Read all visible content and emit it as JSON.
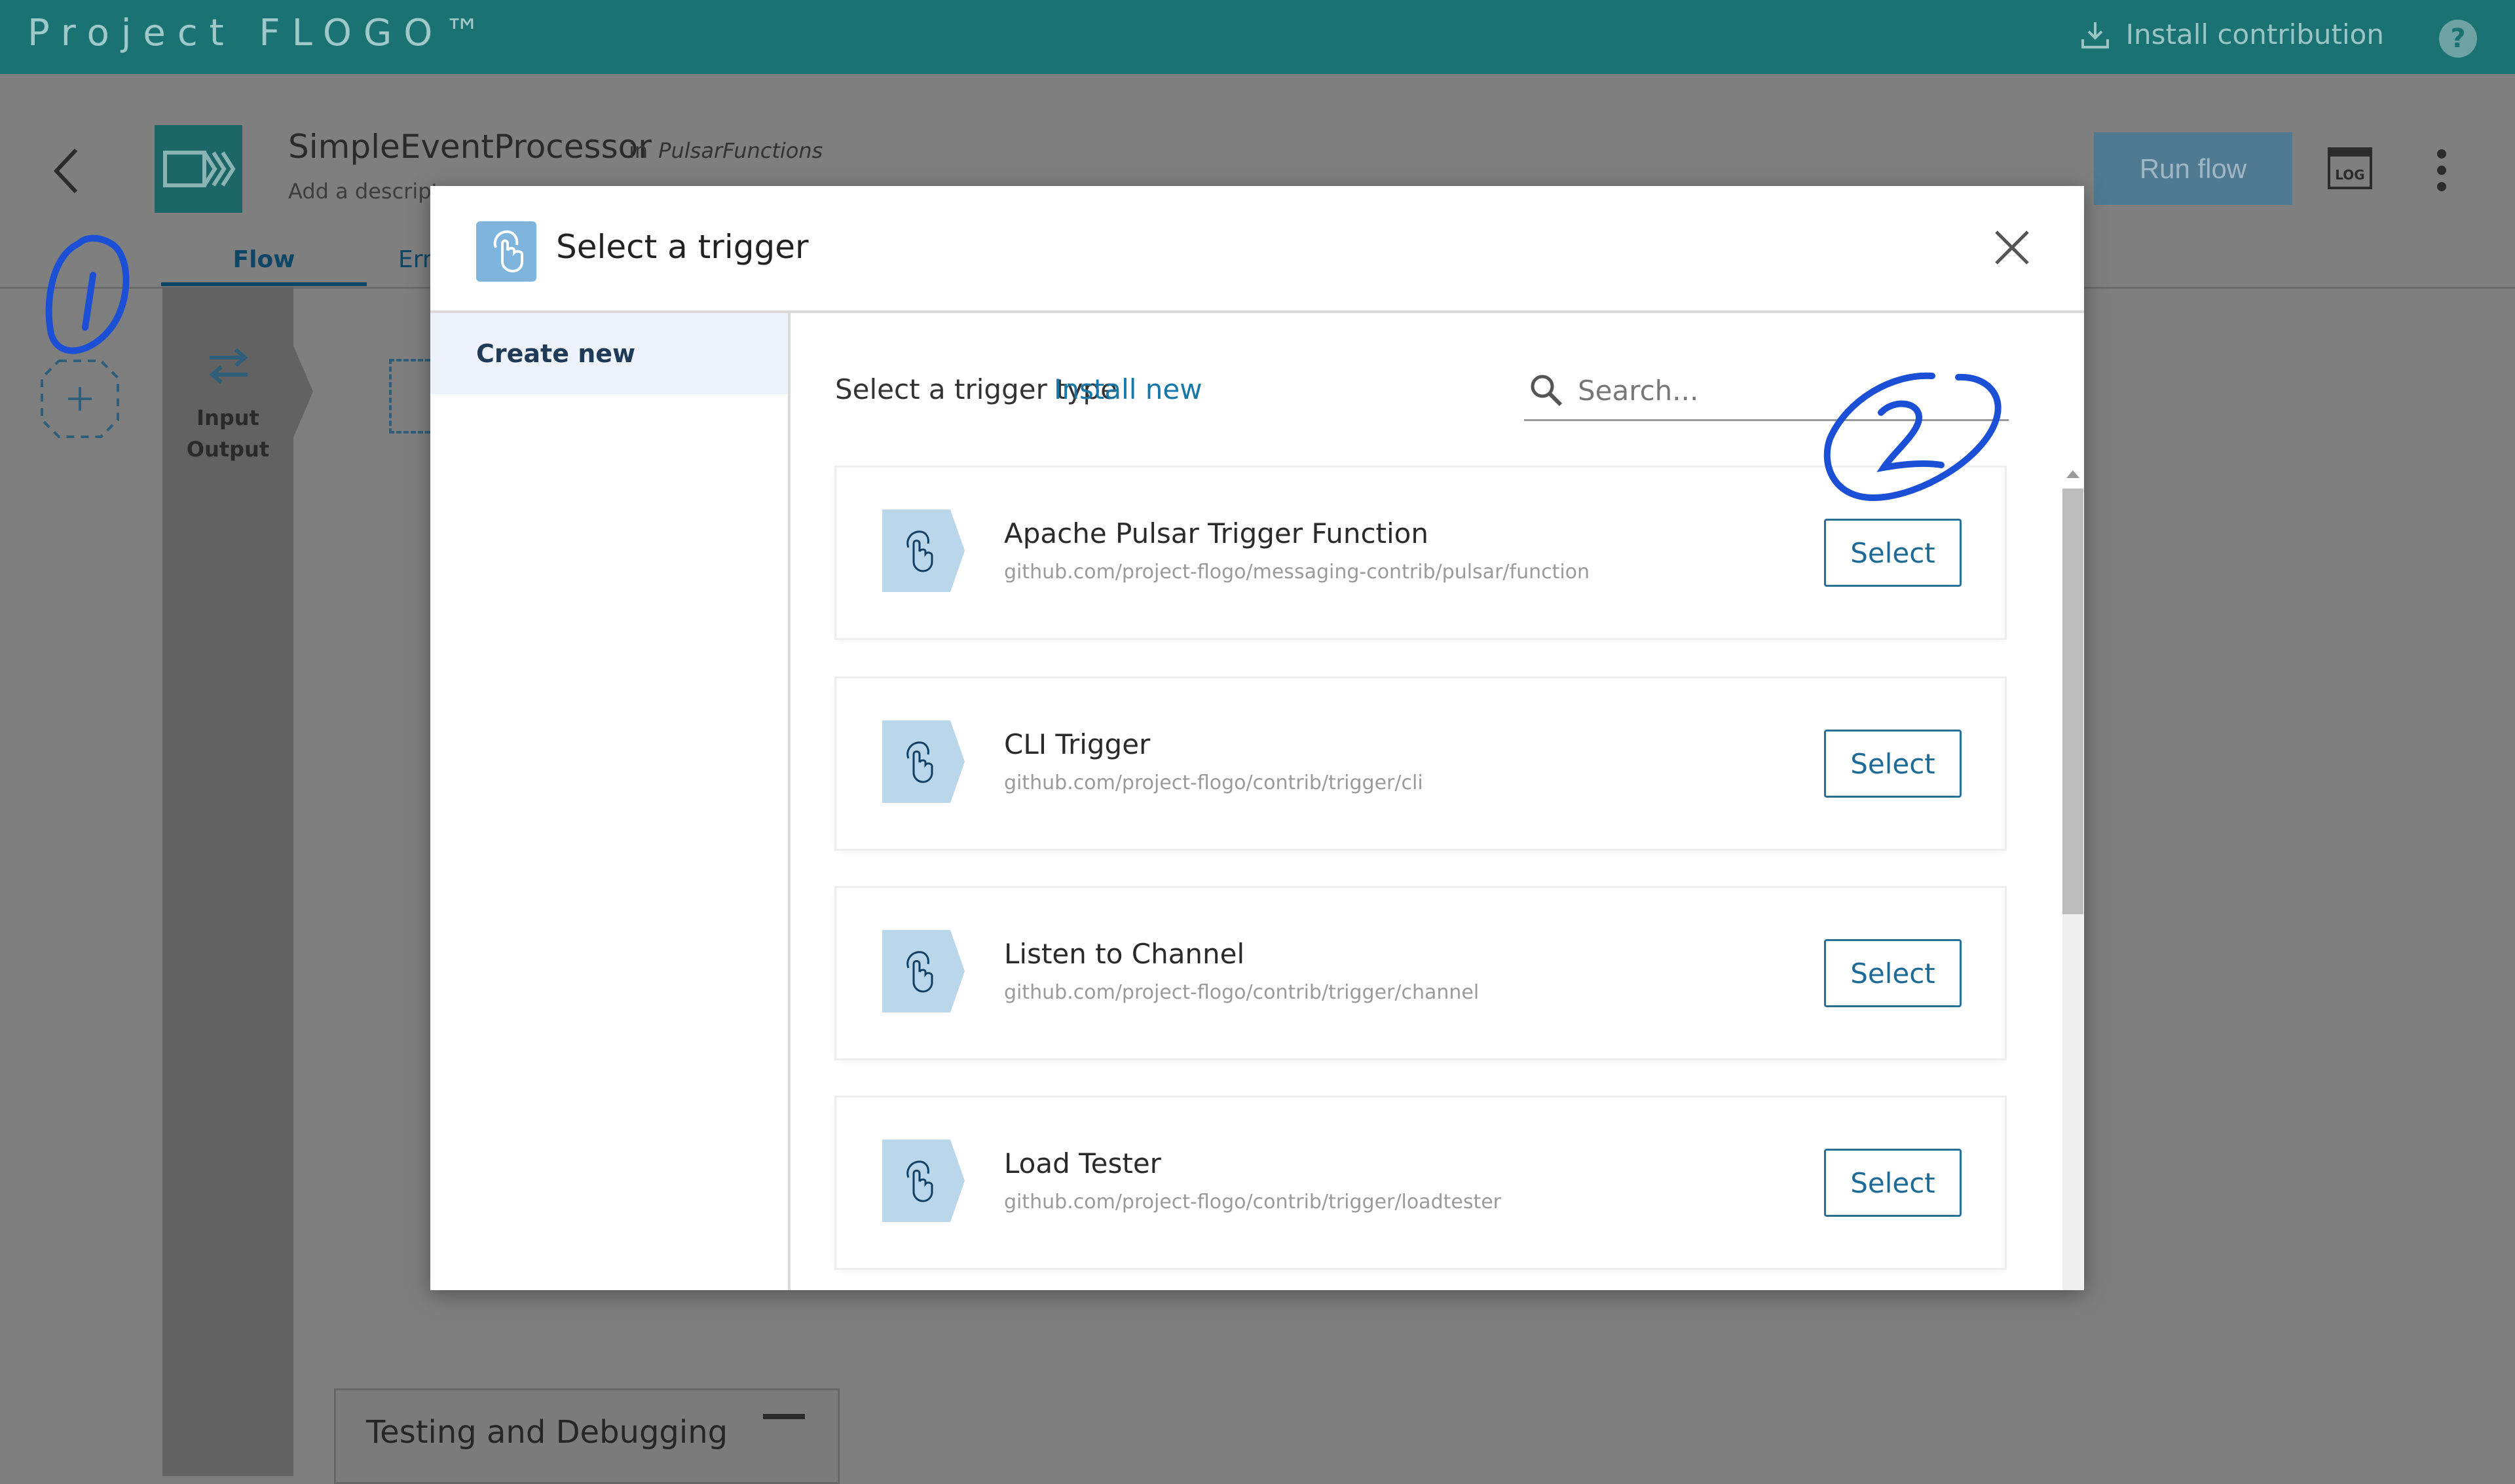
{
  "topbar": {
    "brand": "Project FLOGO™",
    "install_contribution": "Install contribution",
    "help": "?"
  },
  "header": {
    "flow_name": "SimpleEventProcessor",
    "in_label": "in",
    "app_name": "PulsarFunctions",
    "description_placeholder": "Add a descript",
    "tabs": [
      {
        "label": "Flow",
        "active": true
      },
      {
        "label": "Err",
        "active": false
      }
    ],
    "run_flow": "Run flow",
    "log_label": "LOG"
  },
  "canvas": {
    "io_label_1": "Input",
    "io_label_2": "Output",
    "testing_title": "Testing and Debugging"
  },
  "modal": {
    "title": "Select a trigger",
    "sidebar_items": [
      {
        "label": "Create new",
        "active": true
      }
    ],
    "type_label": "Select a trigger type",
    "install_new": "Install new",
    "search_placeholder": "Search...",
    "triggers": [
      {
        "name": "Apache Pulsar Trigger Function",
        "ref": "github.com/project-flogo/messaging-contrib/pulsar/function",
        "action": "Select"
      },
      {
        "name": "CLI Trigger",
        "ref": "github.com/project-flogo/contrib/trigger/cli",
        "action": "Select"
      },
      {
        "name": "Listen to Channel",
        "ref": "github.com/project-flogo/contrib/trigger/channel",
        "action": "Select"
      },
      {
        "name": "Load Tester",
        "ref": "github.com/project-flogo/contrib/trigger/loadtester",
        "action": "Select"
      }
    ]
  },
  "colors": {
    "topbar": "#1b7273",
    "accent": "#1578a8",
    "select_border": "#2a6f95",
    "annotation": "#1a4fd6"
  }
}
